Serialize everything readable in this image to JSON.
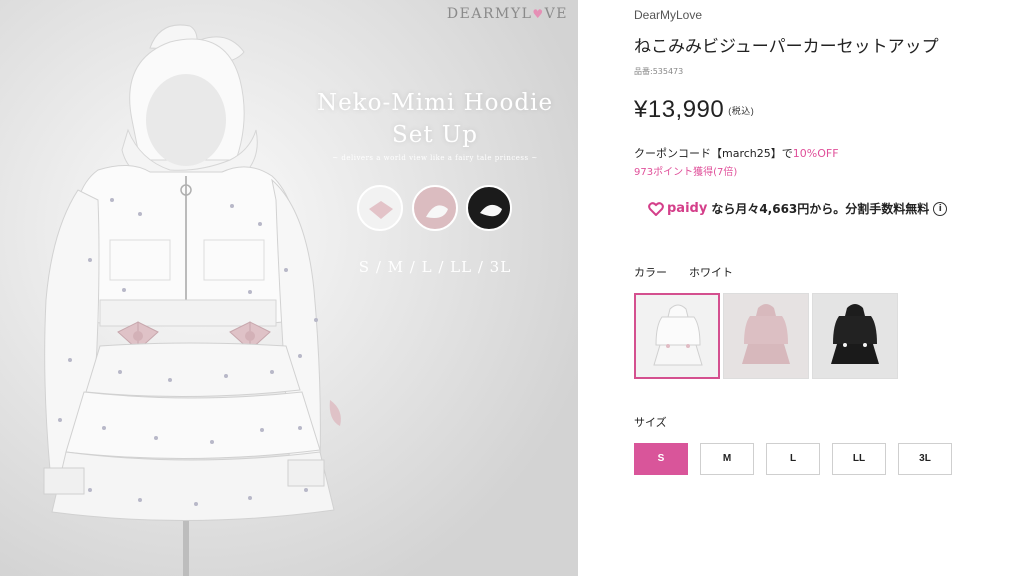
{
  "hero": {
    "logo_text": "DEARMYL",
    "logo_heart": "♥",
    "logo_tail": "VE",
    "title_line1": "Neko-Mimi Hoodie",
    "title_line2": "Set Up",
    "tagline": "~ delivers a world view like a fairy tale princess ~",
    "sizes": "S / M / L / LL / 3L"
  },
  "product": {
    "brand": "DearMyLove",
    "title": "ねこみみビジューパーカーセットアップ",
    "code": "品番:535473",
    "price": "¥13,990",
    "tax_note": "(税込)",
    "coupon_prefix": "クーポンコード【march25】で",
    "coupon_discount": "10%OFF",
    "points": "973ポイント獲得(7倍)",
    "paidy_brand": "paidy",
    "paidy_text": "なら月々4,663円から。分割手数料無料",
    "info_icon": "i"
  },
  "color": {
    "label": "カラー",
    "selected_value": "ホワイト",
    "options": [
      "white",
      "pink",
      "black"
    ]
  },
  "size": {
    "label": "サイズ",
    "options": [
      "S",
      "M",
      "L",
      "LL",
      "3L"
    ],
    "selected": "S"
  },
  "colors": {
    "accent_pink": "#d9559a",
    "coupon_pink": "#e0509a",
    "hero_bg": "#dcdcdc"
  }
}
